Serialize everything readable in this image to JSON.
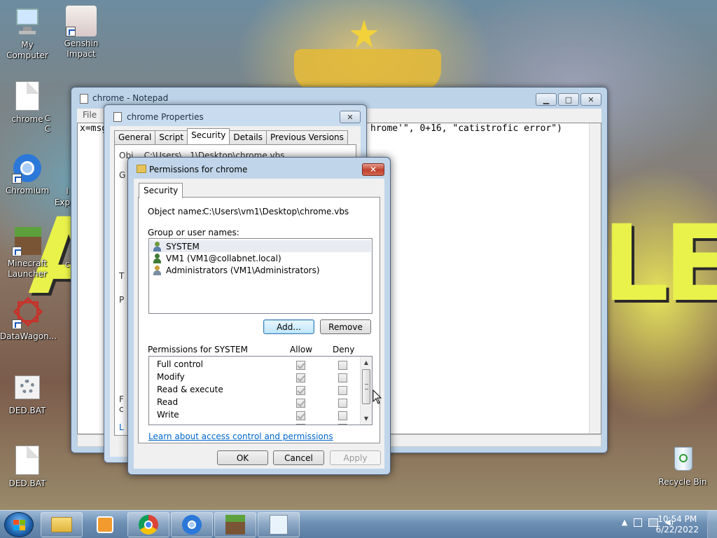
{
  "desktop": {
    "icons": [
      {
        "label": "My Computer",
        "icon": "computer-icon"
      },
      {
        "label": "Genshin Impact",
        "icon": "genshin-icon"
      },
      {
        "label": "chrome",
        "icon": "document-icon"
      },
      {
        "label": "Chromium",
        "icon": "chromium-icon"
      },
      {
        "label": "Minecraft Launcher",
        "icon": "minecraft-icon"
      },
      {
        "label": "DataWagon...",
        "icon": "datawagon-icon"
      },
      {
        "label": "DED.BAT",
        "icon": "gears-icon"
      },
      {
        "label": "DED.BAT",
        "icon": "document-icon"
      },
      {
        "label": "Recycle Bin",
        "icon": "recycle-bin-icon"
      }
    ],
    "peek_labels": [
      "C",
      "C",
      "I",
      "Exp",
      "c"
    ]
  },
  "notepad": {
    "title": "chrome - Notepad",
    "menu_file": "File",
    "content_left": "x=msg",
    "content_right": "hrome'\", 0+16, \"catistrofic error\")"
  },
  "properties": {
    "title": "chrome Properties",
    "tabs": [
      "General",
      "Script",
      "Security",
      "Details",
      "Previous Versions"
    ],
    "active_tab": "Security",
    "object_fragment": "Obj...  C:\\Users\\...1\\Desktop\\chrome.vbs",
    "frag_g": "G",
    "frag_t": "T",
    "frag_p": "P",
    "frag_f": "F",
    "frag_c": "c",
    "frag_l": "L"
  },
  "permissions": {
    "title": "Permissions for chrome",
    "close_glyph": "✕",
    "tab": "Security",
    "object_name_label": "Object name:",
    "object_name_value": "C:\\Users\\vm1\\Desktop\\chrome.vbs",
    "group_label": "Group or user names:",
    "users": [
      {
        "name": "SYSTEM",
        "selected": true
      },
      {
        "name": "VM1 (VM1@collabnet.local)",
        "selected": false
      },
      {
        "name": "Administrators (VM1\\Administrators)",
        "selected": false
      }
    ],
    "add_button": "Add...",
    "remove_button": "Remove",
    "permissions_for_label": "Permissions for SYSTEM",
    "allow_header": "Allow",
    "deny_header": "Deny",
    "rows": [
      {
        "name": "Full control",
        "allow": true,
        "deny": false
      },
      {
        "name": "Modify",
        "allow": true,
        "deny": false
      },
      {
        "name": "Read & execute",
        "allow": true,
        "deny": false
      },
      {
        "name": "Read",
        "allow": true,
        "deny": false
      },
      {
        "name": "Write",
        "allow": true,
        "deny": false
      }
    ],
    "learn_link": "Learn about access control and permissions",
    "ok_button": "OK",
    "cancel_button": "Cancel",
    "apply_button": "Apply"
  },
  "taskbar": {
    "items": [
      "explorer-icon",
      "media-player-icon",
      "chrome-icon",
      "chromium-icon",
      "minecraft-icon",
      "notepad-icon"
    ],
    "clock_time": "10:54 PM",
    "clock_date": "6/22/2022"
  },
  "colors": {
    "title_active": "#c1d5ea",
    "close_red": "#c0412e",
    "link": "#0066cc",
    "taskbar": "#6d8fb4"
  }
}
